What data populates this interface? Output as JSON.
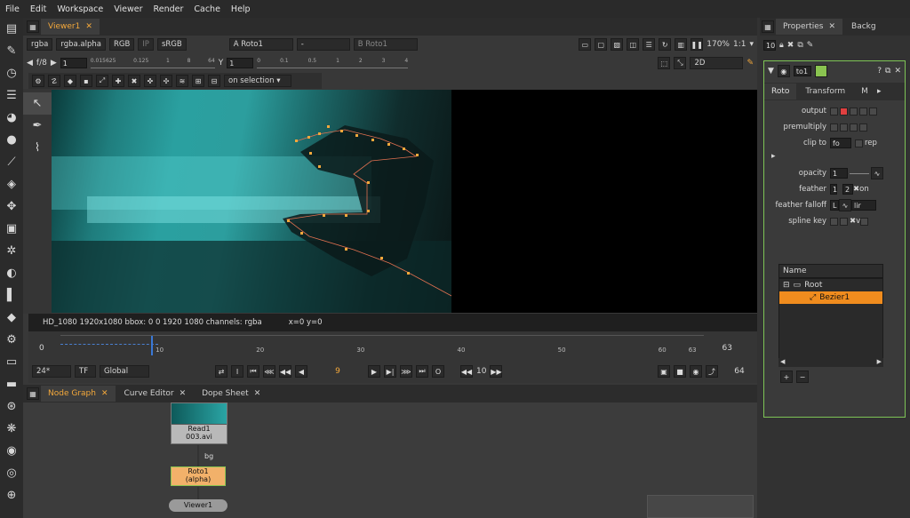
{
  "menu": [
    "File",
    "Edit",
    "Workspace",
    "Viewer",
    "Render",
    "Cache",
    "Help"
  ],
  "viewer": {
    "tab": "Viewer1",
    "channels": "rgba",
    "layer": "rgba.alpha",
    "colorspace_mode": "RGB",
    "ip": "IP",
    "lut": "sRGB",
    "input_a_label": "A",
    "input_a": "Roto1",
    "input_a_op": "-",
    "input_b_label": "B",
    "input_b": "Roto1",
    "zoom": "170%",
    "proxy_ratio": "1:1",
    "fstop": "f/8",
    "gain": "1",
    "gamma_label": "Y",
    "gamma": "1",
    "gain_ticks": [
      "0.015625",
      "0.125",
      "1",
      "8",
      "64"
    ],
    "gamma_ticks": [
      "0",
      "0.1",
      "0.5",
      "1",
      "2",
      "3",
      "4"
    ],
    "view_mode": "2D",
    "selection_mode": "on selection",
    "info": "HD_1080 1920x1080  bbox: 0 0 1920 1080 channels: rgba",
    "coords": "x=0 y=0"
  },
  "timeline": {
    "start": "0",
    "end": "63",
    "ticks": [
      "10",
      "20",
      "30",
      "40",
      "50",
      "60",
      "63"
    ],
    "tick_values": [
      10,
      20,
      30,
      40,
      50,
      60,
      63
    ],
    "fps": "24*",
    "tf": "TF",
    "scope": "Global",
    "current_frame": "9",
    "increment": "10",
    "end_frame": "64"
  },
  "nodegraph": {
    "tabs": [
      "Node Graph",
      "Curve Editor",
      "Dope Sheet"
    ],
    "read_node": {
      "name": "Read1",
      "file": "003.avi"
    },
    "roto_node": {
      "name": "Roto1",
      "sub": "(alpha)"
    },
    "viewer_node": "Viewer1",
    "bg_label": "bg"
  },
  "properties": {
    "tabs": [
      "Properties",
      "Backg"
    ],
    "max_panels": "10",
    "node_name": "to1",
    "subtabs": [
      "Roto",
      "Transform",
      "M"
    ],
    "output_label": "output",
    "premultiply_label": "premultiply",
    "clip_to_label": "clip to",
    "clip_to_value": "fo",
    "replace_label": "rep",
    "opacity_label": "opacity",
    "opacity_value": "1",
    "feather_label": "feather",
    "feather_value": "1",
    "feather_value2": "2",
    "feather_on": "on",
    "feather_falloff_label": "feather falloff",
    "feather_falloff_value": "L",
    "feather_falloff_type": "lir",
    "spline_key_label": "spline key",
    "spline_key_v": "v",
    "tree_header": "Name",
    "tree_root": "Root",
    "tree_item": "Bezier1",
    "add": "+",
    "remove": "−"
  },
  "colors": {
    "accent": "#f3a83b",
    "selected_row": "#f08c1e",
    "panel_border": "#7ec456"
  }
}
